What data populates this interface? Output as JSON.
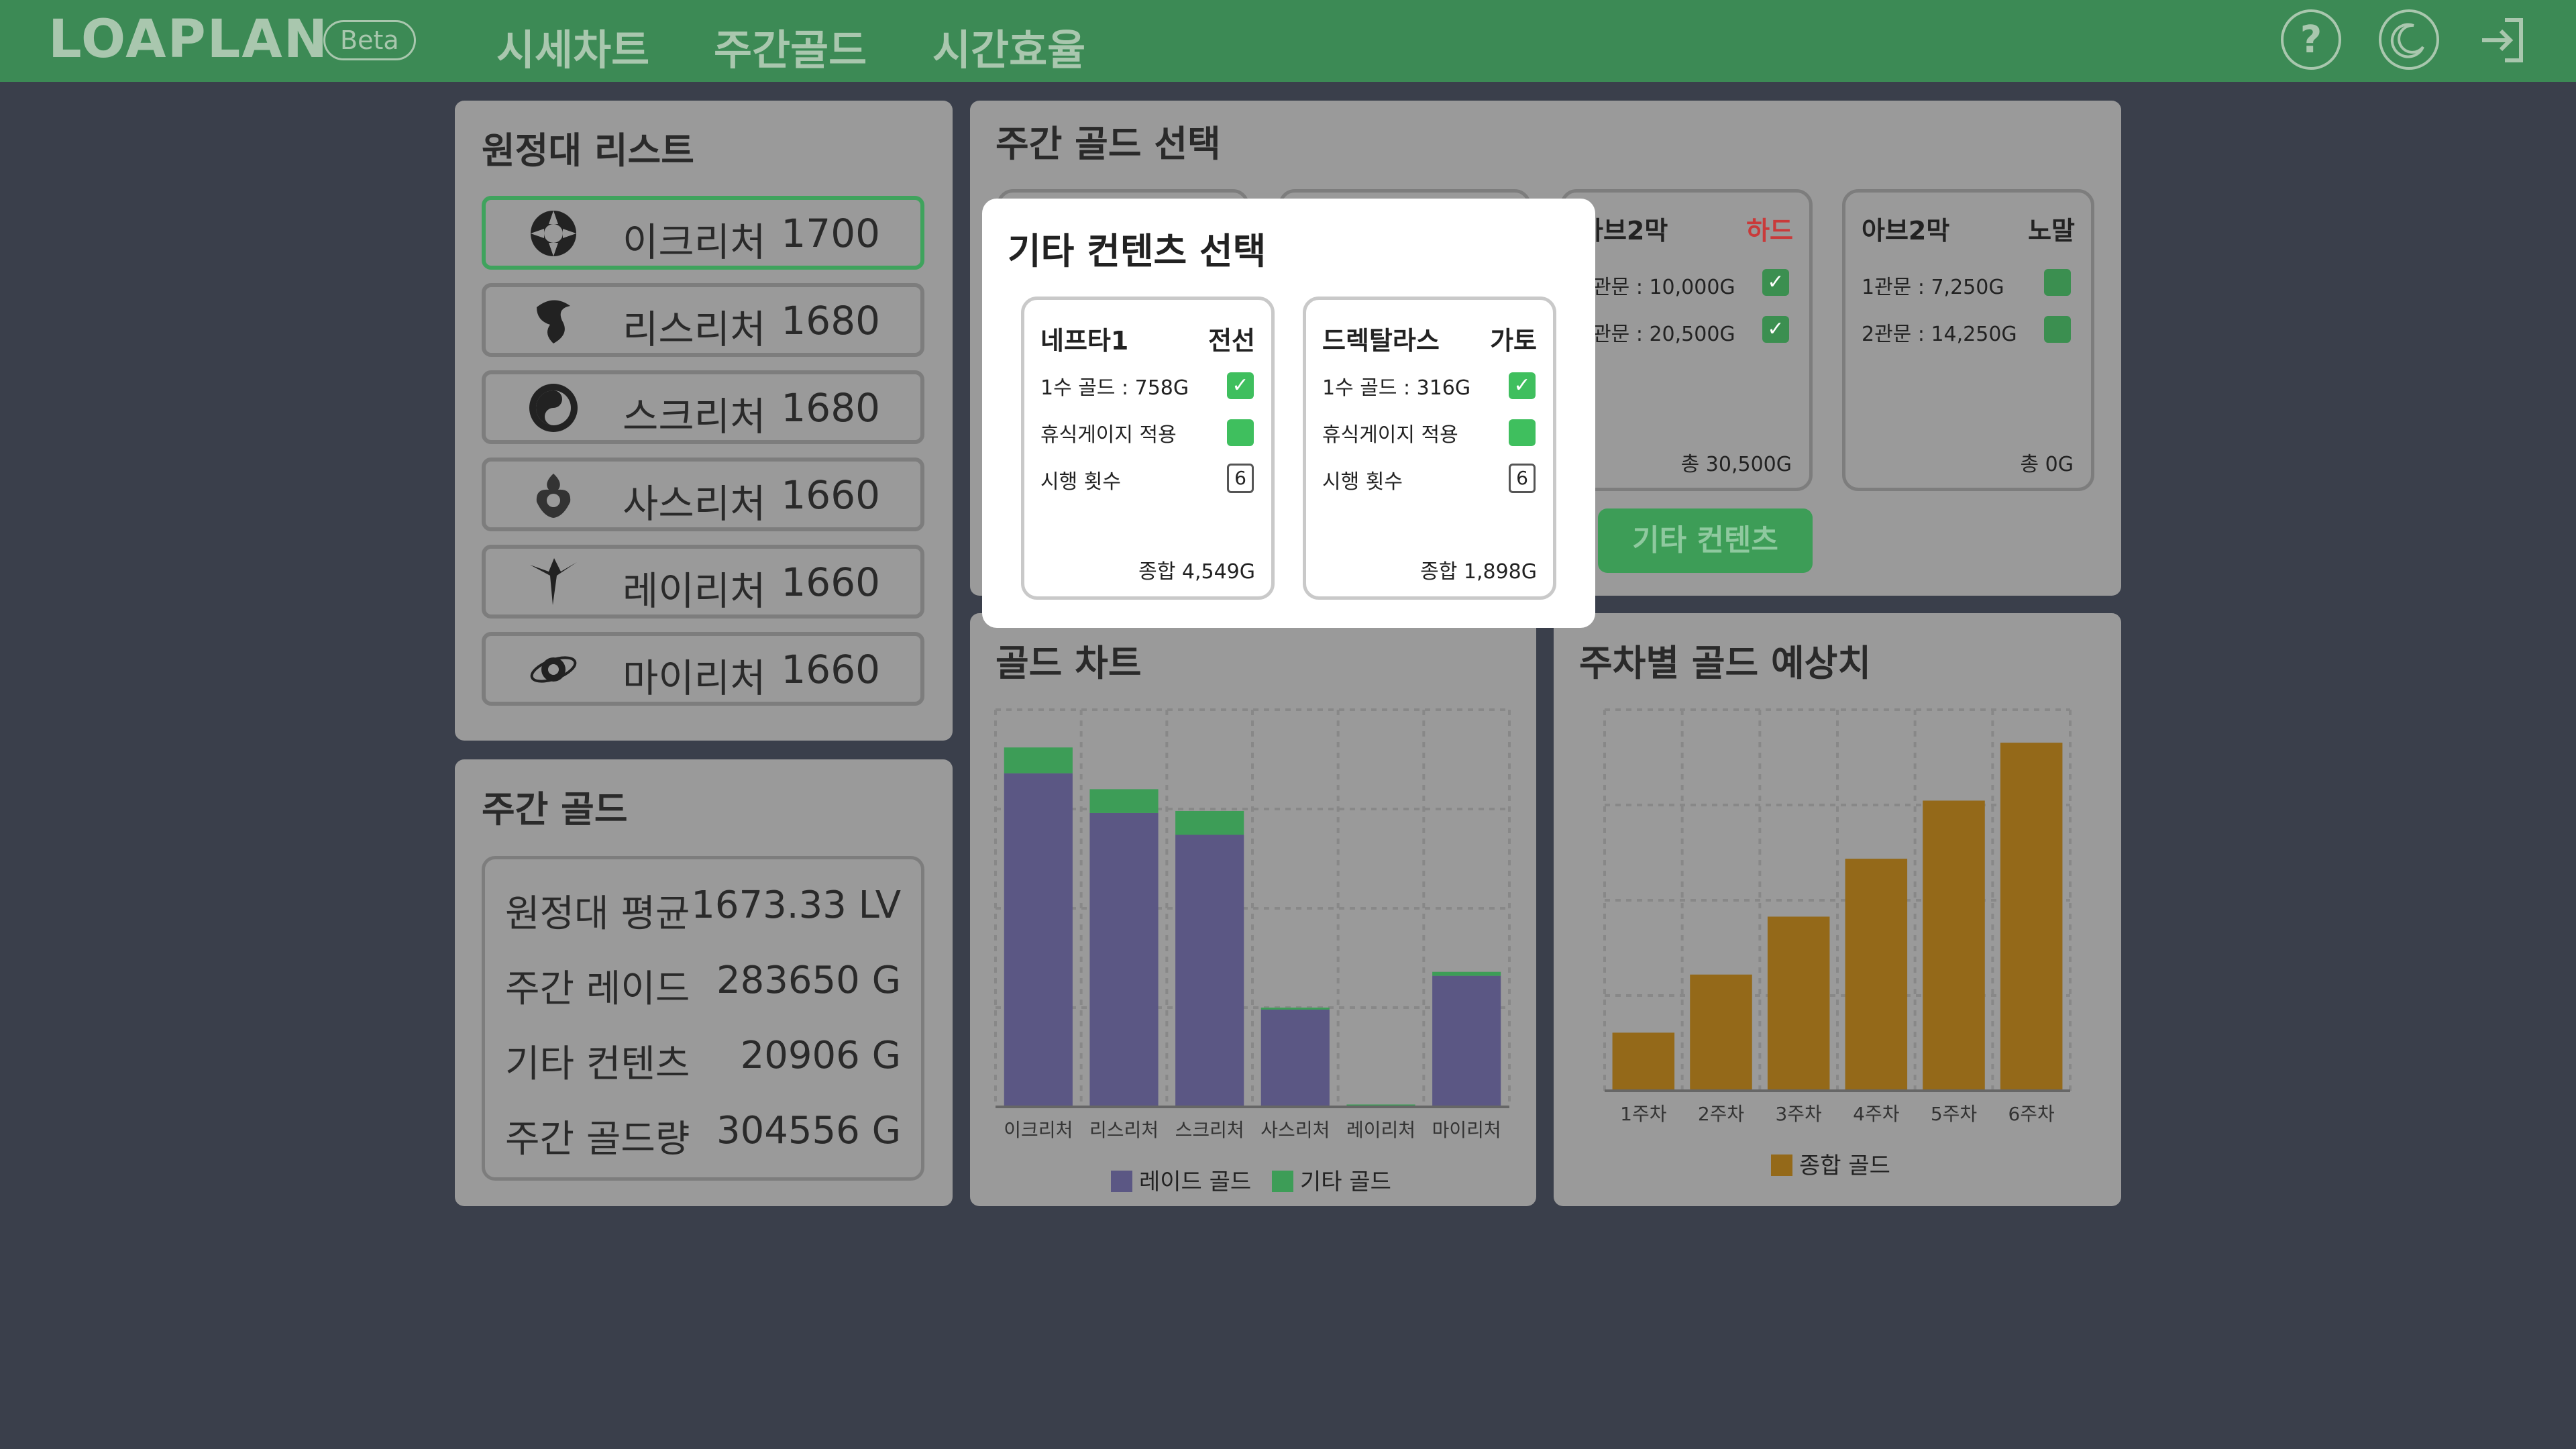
{
  "app": {
    "logo": "LOAPLAN",
    "badge": "Beta",
    "nav": [
      "시세차트",
      "주간골드",
      "시간효율"
    ],
    "icons": [
      "help-icon",
      "moon-icon",
      "login-icon"
    ]
  },
  "raid_list": {
    "title": "원정대 리스트",
    "items": [
      {
        "name": "이크리처",
        "level": "1700",
        "selected": true
      },
      {
        "name": "리스리처",
        "level": "1680"
      },
      {
        "name": "스크리처",
        "level": "1680"
      },
      {
        "name": "사스리처",
        "level": "1660"
      },
      {
        "name": "레이리처",
        "level": "1660"
      },
      {
        "name": "마이리처",
        "level": "1660"
      }
    ]
  },
  "weekly_gold": {
    "title": "주간 골드",
    "rows": [
      {
        "label": "원정대 평균",
        "value": "1673.33 LV"
      },
      {
        "label": "주간 레이드",
        "value": "283650 G"
      },
      {
        "label": "기타 컨텐츠",
        "value": "20906 G"
      },
      {
        "label": "주간 골드량",
        "value": "304556 G"
      }
    ]
  },
  "gold_select": {
    "title": "주간 골드 선택",
    "cards": [
      {
        "name": "아브2막",
        "difficulty": "하드",
        "difficulty_color": "#c93a3a",
        "rows": [
          {
            "label": "1관문 : 10,000G",
            "checked": true
          },
          {
            "label": "2관문 : 20,500G",
            "checked": true
          }
        ],
        "total": "총 30,500G"
      },
      {
        "name": "아브2막",
        "difficulty": "노말",
        "difficulty_color": "#2a2a2a",
        "rows": [
          {
            "label": "1관문 : 7,250G",
            "checked": false
          },
          {
            "label": "2관문 : 14,250G",
            "checked": false
          }
        ],
        "total": "총 0G"
      }
    ],
    "other_button": "기타 컨텐츠"
  },
  "modal": {
    "title": "기타 컨텐츠 선택",
    "cards": [
      {
        "name": "네프타1",
        "type": "전선",
        "gold_label": "1수 골드 : 758G",
        "rest_label": "휴식게이지 적용",
        "count_label": "시행 횟수",
        "count_value": "6",
        "total": "종합 4,549G"
      },
      {
        "name": "드렉탈라스",
        "type": "가토",
        "gold_label": "1수 골드 : 316G",
        "rest_label": "휴식게이지 적용",
        "count_label": "시행 횟수",
        "count_value": "6",
        "total": "종합 1,898G"
      }
    ]
  },
  "colors": {
    "raid_gold": "#5b5784",
    "other_gold": "#3d9d57",
    "total_gold": "#946919",
    "accent": "#3c8a55"
  },
  "gold_chart": {
    "title": "골드 차트",
    "chart_data": {
      "type": "bar",
      "stacked": true,
      "categories": [
        "이크리처",
        "리스리처",
        "스크리처",
        "사스리처",
        "레이리처",
        "마이리처"
      ],
      "series": [
        {
          "name": "레이드 골드",
          "values": [
            84000,
            74000,
            68500,
            24500,
            0,
            33000
          ]
        },
        {
          "name": "기타 골드",
          "values": [
            6500,
            6000,
            6000,
            500,
            600,
            1000
          ]
        }
      ],
      "ylim": [
        0,
        100000
      ],
      "grid": true,
      "legend": "bottom"
    }
  },
  "weekly_forecast": {
    "title": "주차별 골드 예상치",
    "chart_data": {
      "type": "bar",
      "categories": [
        "1주차",
        "2주차",
        "3주차",
        "4주차",
        "5주차",
        "6주차"
      ],
      "series": [
        {
          "name": "종합 골드",
          "values": [
            305000,
            610000,
            914000,
            1218000,
            1523000,
            1827000
          ]
        }
      ],
      "ylim": [
        0,
        2000000
      ],
      "grid": true,
      "legend": "bottom"
    }
  }
}
